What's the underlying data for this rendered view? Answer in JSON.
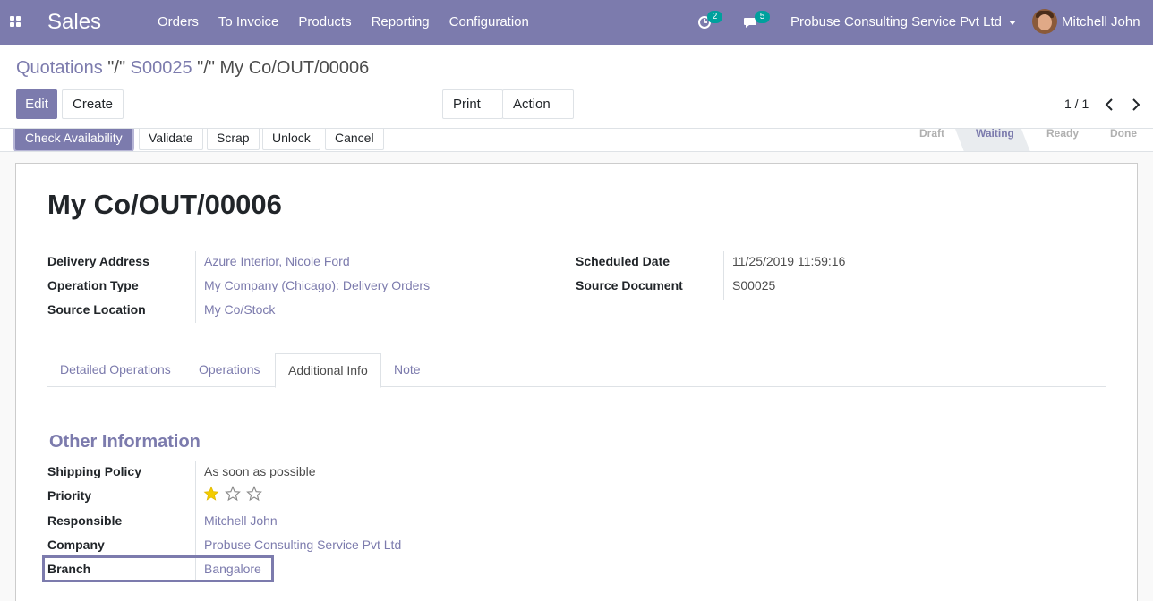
{
  "navbar": {
    "app_name": "Sales",
    "menu": [
      "Orders",
      "To Invoice",
      "Products",
      "Reporting",
      "Configuration"
    ],
    "activity_badge": "2",
    "messages_badge": "5",
    "company": "Probuse Consulting Service Pvt Ltd",
    "user": "Mitchell John"
  },
  "breadcrumb": {
    "part1": "Quotations",
    "sep1": "\"/\"",
    "part2": "S00025",
    "sep2": "\"/\"",
    "current": "My Co/OUT/00006"
  },
  "toolbar": {
    "edit": "Edit",
    "create": "Create",
    "print": "Print",
    "action": "Action",
    "pager": "1 / 1"
  },
  "statusbar": {
    "buttons": [
      "Check Availability",
      "Validate",
      "Scrap",
      "Unlock",
      "Cancel"
    ],
    "stages": [
      "Draft",
      "Waiting",
      "Ready",
      "Done"
    ],
    "active_stage": "Waiting"
  },
  "record": {
    "title": "My Co/OUT/00006",
    "fields_left": [
      {
        "label": "Delivery Address",
        "value": "Azure Interior, Nicole Ford"
      },
      {
        "label": "Operation Type",
        "value": "My Company (Chicago): Delivery Orders"
      },
      {
        "label": "Source Location",
        "value": "My Co/Stock"
      }
    ],
    "fields_right": [
      {
        "label": "Scheduled Date",
        "value": "11/25/2019 11:59:16"
      },
      {
        "label": "Source Document",
        "value": "S00025"
      }
    ]
  },
  "tabs": [
    "Detailed Operations",
    "Operations",
    "Additional Info",
    "Note"
  ],
  "active_tab": "Additional Info",
  "other_info": {
    "title": "Other Information",
    "shipping_policy_label": "Shipping Policy",
    "shipping_policy": "As soon as possible",
    "priority_label": "Priority",
    "priority_stars": 1,
    "priority_max": 3,
    "responsible_label": "Responsible",
    "responsible": "Mitchell John",
    "company_label": "Company",
    "company": "Probuse Consulting Service Pvt Ltd",
    "branch_label": "Branch",
    "branch": "Bangalore"
  },
  "colors": {
    "brand": "#7c7bad",
    "badge": "#00a09d",
    "star_filled": "#f3cc00"
  }
}
